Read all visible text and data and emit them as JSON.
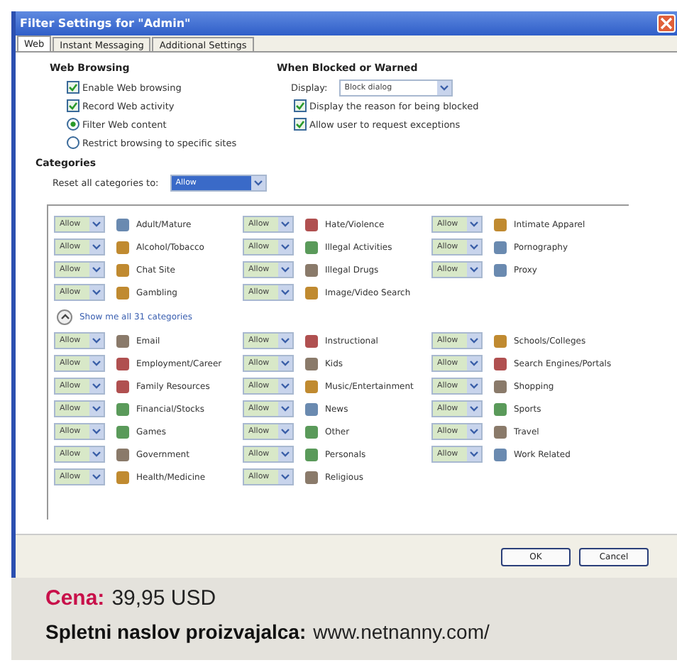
{
  "window": {
    "title": "Filter Settings for \"Admin\""
  },
  "tabs": [
    {
      "label": "Web",
      "selected": true
    },
    {
      "label": "Instant Messaging",
      "selected": false
    },
    {
      "label": "Additional Settings",
      "selected": false
    }
  ],
  "web_browsing": {
    "heading": "Web Browsing",
    "options": [
      {
        "kind": "checkbox",
        "label": "Enable Web browsing",
        "checked": true
      },
      {
        "kind": "checkbox",
        "label": "Record Web activity",
        "checked": true
      },
      {
        "kind": "radio",
        "label": "Filter Web content",
        "selected": true
      },
      {
        "kind": "radio",
        "label": "Restrict browsing to specific sites",
        "selected": false
      }
    ]
  },
  "when_blocked": {
    "heading": "When Blocked or Warned",
    "display_label": "Display:",
    "display_value": "Block dialog",
    "options": [
      {
        "label": "Display the reason for being blocked",
        "checked": true
      },
      {
        "label": "Allow user to request exceptions",
        "checked": true
      }
    ]
  },
  "categories": {
    "heading": "Categories",
    "reset_label": "Reset all categories to:",
    "reset_value": "Allow",
    "common": [
      [
        {
          "label": "Adult/Mature",
          "value": "Allow"
        },
        {
          "label": "Alcohol/Tobacco",
          "value": "Allow"
        },
        {
          "label": "Chat Site",
          "value": "Allow"
        },
        {
          "label": "Gambling",
          "value": "Allow"
        }
      ],
      [
        {
          "label": "Hate/Violence",
          "value": "Allow"
        },
        {
          "label": "Illegal Activities",
          "value": "Allow"
        },
        {
          "label": "Illegal Drugs",
          "value": "Allow"
        },
        {
          "label": "Image/Video Search",
          "value": "Allow"
        }
      ],
      [
        {
          "label": "Intimate Apparel",
          "value": "Allow"
        },
        {
          "label": "Pornography",
          "value": "Allow"
        },
        {
          "label": "Proxy",
          "value": "Allow"
        }
      ]
    ],
    "show_all": "Show me all 31 categories",
    "more": [
      [
        {
          "label": "Email",
          "value": "Allow"
        },
        {
          "label": "Employment/Career",
          "value": "Allow"
        },
        {
          "label": "Family Resources",
          "value": "Allow"
        },
        {
          "label": "Financial/Stocks",
          "value": "Allow"
        },
        {
          "label": "Games",
          "value": "Allow"
        },
        {
          "label": "Government",
          "value": "Allow"
        },
        {
          "label": "Health/Medicine",
          "value": "Allow"
        }
      ],
      [
        {
          "label": "Instructional",
          "value": "Allow"
        },
        {
          "label": "Kids",
          "value": "Allow"
        },
        {
          "label": "Music/Entertainment",
          "value": "Allow"
        },
        {
          "label": "News",
          "value": "Allow"
        },
        {
          "label": "Other",
          "value": "Allow"
        },
        {
          "label": "Personals",
          "value": "Allow"
        },
        {
          "label": "Religious",
          "value": "Allow"
        }
      ],
      [
        {
          "label": "Schools/Colleges",
          "value": "Allow"
        },
        {
          "label": "Search Engines/Portals",
          "value": "Allow"
        },
        {
          "label": "Shopping",
          "value": "Allow"
        },
        {
          "label": "Sports",
          "value": "Allow"
        },
        {
          "label": "Travel",
          "value": "Allow"
        },
        {
          "label": "Work Related",
          "value": "Allow"
        }
      ]
    ]
  },
  "buttons": [
    "OK",
    "Cancel"
  ],
  "caption": {
    "price_label": "Cena:",
    "price": "39,95 USD",
    "url_label": "Spletni naslov proizvajalca:",
    "url": "www.netnanny.com/"
  }
}
